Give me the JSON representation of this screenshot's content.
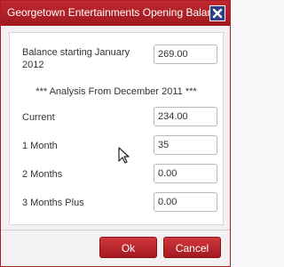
{
  "dialog": {
    "title": "Georgetown Entertainments Opening Balance"
  },
  "form": {
    "balance_label": "Balance starting January 2012",
    "balance_value": "269.00",
    "analysis_heading": "*** Analysis From December 2011 ***",
    "rows": [
      {
        "label": "Current",
        "value": "234.00"
      },
      {
        "label": "1 Month",
        "value": "35"
      },
      {
        "label": "2 Months",
        "value": "0.00"
      },
      {
        "label": "3 Months Plus",
        "value": "0.00"
      }
    ]
  },
  "buttons": {
    "ok_label": "Ok",
    "cancel_label": "Cancel"
  },
  "colors": {
    "titlebar": "#b02228",
    "close_button": "#2f3f85",
    "button": "#c0282e"
  },
  "icons": {
    "close": "close-icon",
    "cursor": "mouse-cursor-icon"
  }
}
